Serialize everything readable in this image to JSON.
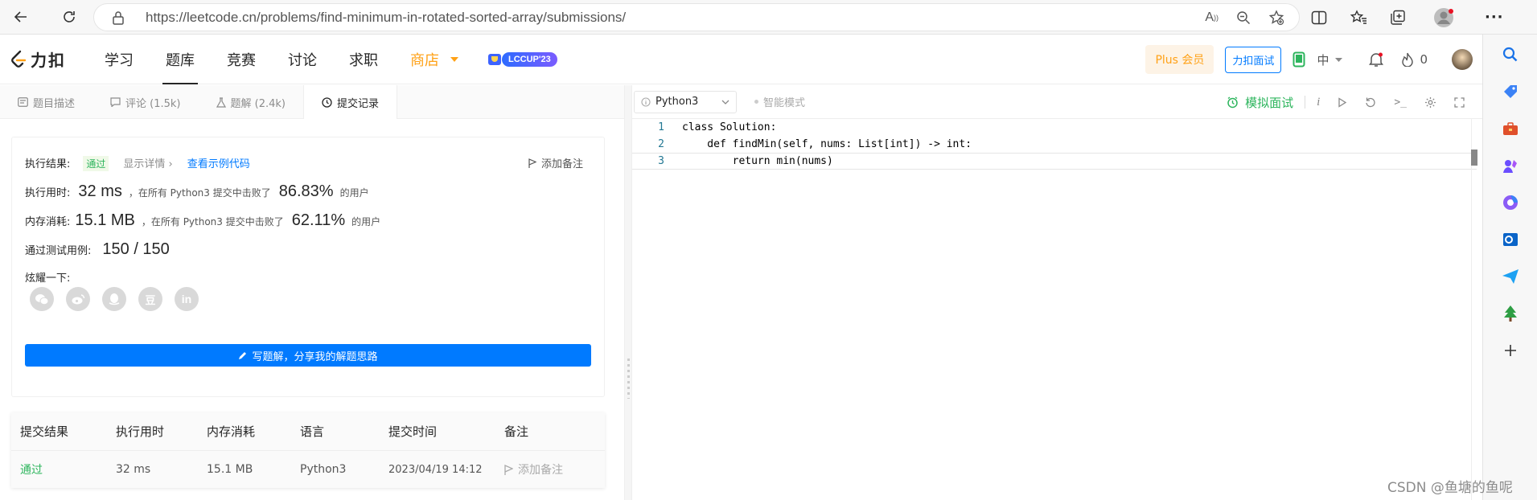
{
  "browser": {
    "url": "https://leetcode.cn/problems/find-minimum-in-rotated-sorted-array/submissions/"
  },
  "header": {
    "logo_text": "力扣",
    "nav": [
      {
        "label": "学习"
      },
      {
        "label": "题库"
      },
      {
        "label": "竞赛"
      },
      {
        "label": "讨论"
      },
      {
        "label": "求职"
      },
      {
        "label": "商店"
      }
    ],
    "lccup_label": "LCCUP'23",
    "plus_label": "Plus 会员",
    "interview_label": "力扣面试",
    "lang_label": "中",
    "fire_count": "0"
  },
  "left_tabs": [
    {
      "label": "题目描述"
    },
    {
      "label": "评论 (1.5k)"
    },
    {
      "label": "题解 (2.4k)"
    },
    {
      "label": "提交记录"
    }
  ],
  "result": {
    "result_label": "执行结果:",
    "status": "通过",
    "detail_link": "显示详情 ›",
    "example_link": "查看示例代码",
    "add_note": "添加备注",
    "runtime_label": "执行用时:",
    "runtime_value": "32 ms",
    "runtime_beat_prefix": "，在所有 Python3 提交中击败了",
    "runtime_percent": "86.83%",
    "users_suffix": "的用户",
    "memory_label": "内存消耗:",
    "memory_value": "15.1 MB",
    "memory_beat_prefix": "，在所有 Python3 提交中击败了",
    "memory_percent": "62.11%",
    "tests_label": "通过测试用例:",
    "tests_value": "150 / 150",
    "share_label": "炫耀一下:",
    "write_solution": "写题解，分享我的解题思路"
  },
  "table": {
    "headers": [
      "提交结果",
      "执行用时",
      "内存消耗",
      "语言",
      "提交时间",
      "备注"
    ],
    "rows": [
      {
        "status": "通过",
        "runtime": "32 ms",
        "memory": "15.1 MB",
        "language": "Python3",
        "time": "2023/04/19 14:12",
        "note": "添加备注"
      }
    ]
  },
  "editor": {
    "language": "Python3",
    "smart_mode": "智能模式",
    "mock_interview": "模拟面试",
    "lines": [
      {
        "num": "1",
        "text": "class Solution:"
      },
      {
        "num": "2",
        "text": "    def findMin(self, nums: List[int]) -> int:"
      },
      {
        "num": "3",
        "text": "        return min(nums)"
      }
    ]
  },
  "watermark": "CSDN @鱼塘的鱼呢",
  "colors": {
    "accent": "#007aff",
    "success": "#2db55d",
    "brand_orange": "#ffa116"
  }
}
